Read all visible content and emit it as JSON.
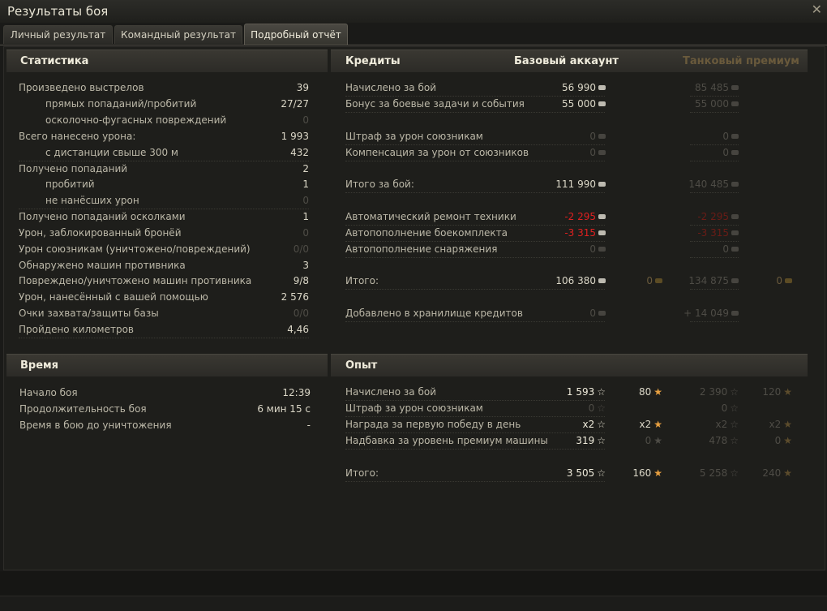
{
  "window": {
    "title": "Результаты боя"
  },
  "tabs": [
    "Личный результат",
    "Командный результат",
    "Подробный отчёт"
  ],
  "stats": {
    "header": "Статистика",
    "rows": [
      {
        "label": "Произведено выстрелов",
        "value": "39"
      },
      {
        "label": "прямых попаданий/пробитий",
        "value": "27/27"
      },
      {
        "label": "осколочно-фугасных повреждений",
        "value": "0"
      },
      {
        "label": "Всего нанесено урона:",
        "value": "1 993"
      },
      {
        "label": "с дистанции свыше 300 м",
        "value": "432"
      },
      {
        "label": "Получено попаданий",
        "value": "2"
      },
      {
        "label": "пробитий",
        "value": "1"
      },
      {
        "label": "не нанёсших урон",
        "value": "0"
      },
      {
        "label": "Получено попаданий осколками",
        "value": "1"
      },
      {
        "label": "Урон, заблокированный бронёй",
        "value": "0"
      },
      {
        "label": "Урон союзникам (уничтожено/повреждений)",
        "value": "0/0"
      },
      {
        "label": "Обнаружено машин противника",
        "value": "3"
      },
      {
        "label": "Повреждено/уничтожено машин противника",
        "value": "9/8"
      },
      {
        "label": "Урон, нанесённый с вашей помощью",
        "value": "2 576"
      },
      {
        "label": "Очки захвата/защиты базы",
        "value": "0/0"
      },
      {
        "label": "Пройдено километров",
        "value": "4,46"
      }
    ]
  },
  "time": {
    "header": "Время",
    "rows": [
      {
        "label": "Начало боя",
        "value": "12:39"
      },
      {
        "label": "Продолжительность боя",
        "value": "6 мин 15 с"
      },
      {
        "label": "Время в бою до уничтожения",
        "value": "-"
      }
    ]
  },
  "credits": {
    "header": "Кредиты",
    "col_base": "Базовый аккаунт",
    "col_premium": "Танковый премиум",
    "rows": [
      {
        "label": "Начислено за бой",
        "base": "56 990",
        "premium": "85 485"
      },
      {
        "label": "Бонус за боевые задачи и события",
        "base": "55 000",
        "premium": "55 000"
      },
      {
        "label": "Штраф за урон союзникам",
        "base": "0",
        "premium": "0"
      },
      {
        "label": "Компенсация за урон от союзников",
        "base": "0",
        "premium": "0"
      },
      {
        "label": "Итого за бой:",
        "base": "111 990",
        "premium": "140 485"
      },
      {
        "label": "Автоматический ремонт техники",
        "base": "-2 295",
        "premium": "-2 295"
      },
      {
        "label": "Автопополнение боекомплекта",
        "base": "-3 315",
        "premium": "-3 315"
      },
      {
        "label": "Автопополнение снаряжения",
        "base": "0",
        "premium": "0"
      },
      {
        "label": "Итого:",
        "base": "106 380",
        "base_gold": "0",
        "premium": "134 875",
        "premium_gold": "0"
      },
      {
        "label": "Добавлено в хранилище кредитов",
        "base": "0",
        "premium": "+ 14 049"
      }
    ]
  },
  "experience": {
    "header": "Опыт",
    "rows": [
      {
        "label": "Начислено за бой",
        "base": "1 593",
        "base_free": "80",
        "premium": "2 390",
        "premium_free": "120"
      },
      {
        "label": "Штраф за урон союзникам",
        "base": "0",
        "base_free": "",
        "premium": "0",
        "premium_free": ""
      },
      {
        "label": "Награда за первую победу в день",
        "base": "x2",
        "base_free": "x2",
        "premium": "x2",
        "premium_free": "x2"
      },
      {
        "label": "Надбавка за уровень премиум машины",
        "base": "319",
        "base_free": "0",
        "premium": "478",
        "premium_free": "0"
      },
      {
        "label": "Итого:",
        "base": "3 505",
        "base_free": "160",
        "premium": "5 258",
        "premium_free": "240"
      }
    ]
  },
  "icons": {
    "close": "close-icon",
    "credit": "credit-icon",
    "gold": "gold-icon",
    "xp": "xp-star-icon",
    "free_xp": "free-xp-star-icon"
  },
  "colors": {
    "negative": "#e02020",
    "premium_header": "#6a5a3c",
    "free_xp_star": "#e8a040"
  }
}
